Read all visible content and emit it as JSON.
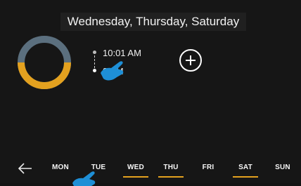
{
  "header": {
    "title": "Wednesday, Thursday, Saturday"
  },
  "schedule": {
    "times": [
      {
        "label": "10:01 AM"
      },
      {
        "label": "8 AM"
      }
    ]
  },
  "days": [
    {
      "label": "MON",
      "selected": false
    },
    {
      "label": "TUE",
      "selected": false
    },
    {
      "label": "WED",
      "selected": true
    },
    {
      "label": "THU",
      "selected": true
    },
    {
      "label": "FRI",
      "selected": false
    },
    {
      "label": "SAT",
      "selected": true
    },
    {
      "label": "SUN",
      "selected": false
    }
  ],
  "colors": {
    "accent": "#e3a11f",
    "ring_track": "#5b6f7e",
    "background": "#161616"
  },
  "icons": {
    "add": "plus-circle-icon",
    "back": "arrow-left-icon",
    "pointer": "hand-pointer-icon"
  }
}
